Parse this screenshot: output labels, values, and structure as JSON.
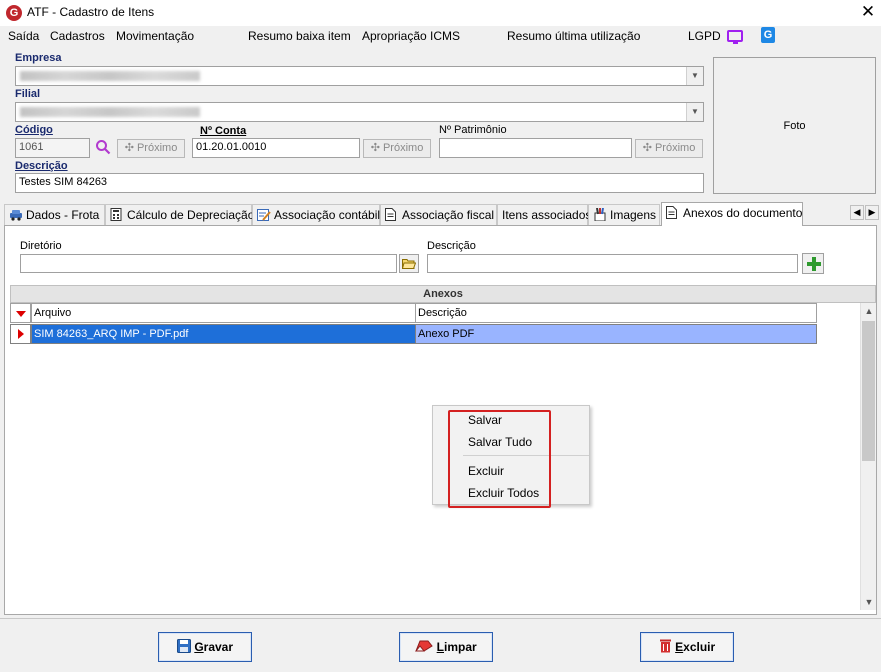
{
  "window": {
    "title": "ATF - Cadastro de Itens",
    "close_glyph": "✕",
    "logo_letter": "G"
  },
  "menu": {
    "items": [
      "Saída",
      "Cadastros",
      "Movimentação",
      "Resumo baixa item",
      "Apropriação ICMS",
      "Resumo última utilização",
      "LGPD"
    ],
    "icons": [
      "monitor-icon",
      "g-app-icon"
    ]
  },
  "form": {
    "empresa_label": "Empresa",
    "filial_label": "Filial",
    "codigo_label": "Código",
    "codigo_value": "1061",
    "proximo_label": "Próximo",
    "nconta_label": "Nº Conta",
    "nconta_value": "01.20.01.0010",
    "patrimonio_label": "Nº Patrimônio",
    "patrimonio_value": "",
    "descricao_label": "Descrição",
    "descricao_value": "Testes SIM 84263",
    "photo_label": "Foto"
  },
  "tabs": [
    {
      "label": "Dados - Frota",
      "icon": "car-icon"
    },
    {
      "label": "Cálculo de Depreciação",
      "icon": "calculator-icon"
    },
    {
      "label": "Associação contábil",
      "icon": "edit-sheet-icon"
    },
    {
      "label": "Associação fiscal",
      "icon": "document-icon"
    },
    {
      "label": "Itens associados",
      "icon": ""
    },
    {
      "label": "Imagens",
      "icon": "paint-icon"
    },
    {
      "label": "Anexos do documento",
      "icon": "document-icon",
      "active": true
    }
  ],
  "anexos_panel": {
    "diretorio_label": "Diretório",
    "diretorio_value": "",
    "descricao_label": "Descrição",
    "descricao_value": "",
    "grid_title": "Anexos",
    "columns": [
      "Arquivo",
      "Descrição"
    ],
    "rows": [
      {
        "arquivo": "SIM 84263_ARQ IMP - PDF.pdf",
        "descricao": "Anexo PDF"
      }
    ]
  },
  "context_menu": {
    "items": [
      "Salvar",
      "Salvar Tudo",
      "Excluir",
      "Excluir Todos"
    ]
  },
  "footer": {
    "gravar": {
      "hotkey": "G",
      "rest": "ravar"
    },
    "limpar": {
      "hotkey": "L",
      "rest": "impar"
    },
    "excluir": {
      "hotkey": "E",
      "rest": "xcluir"
    }
  },
  "colors": {
    "accent_red": "#d42020",
    "selection_blue": "#1e6fd9",
    "label_navy": "#1a2a6e"
  }
}
